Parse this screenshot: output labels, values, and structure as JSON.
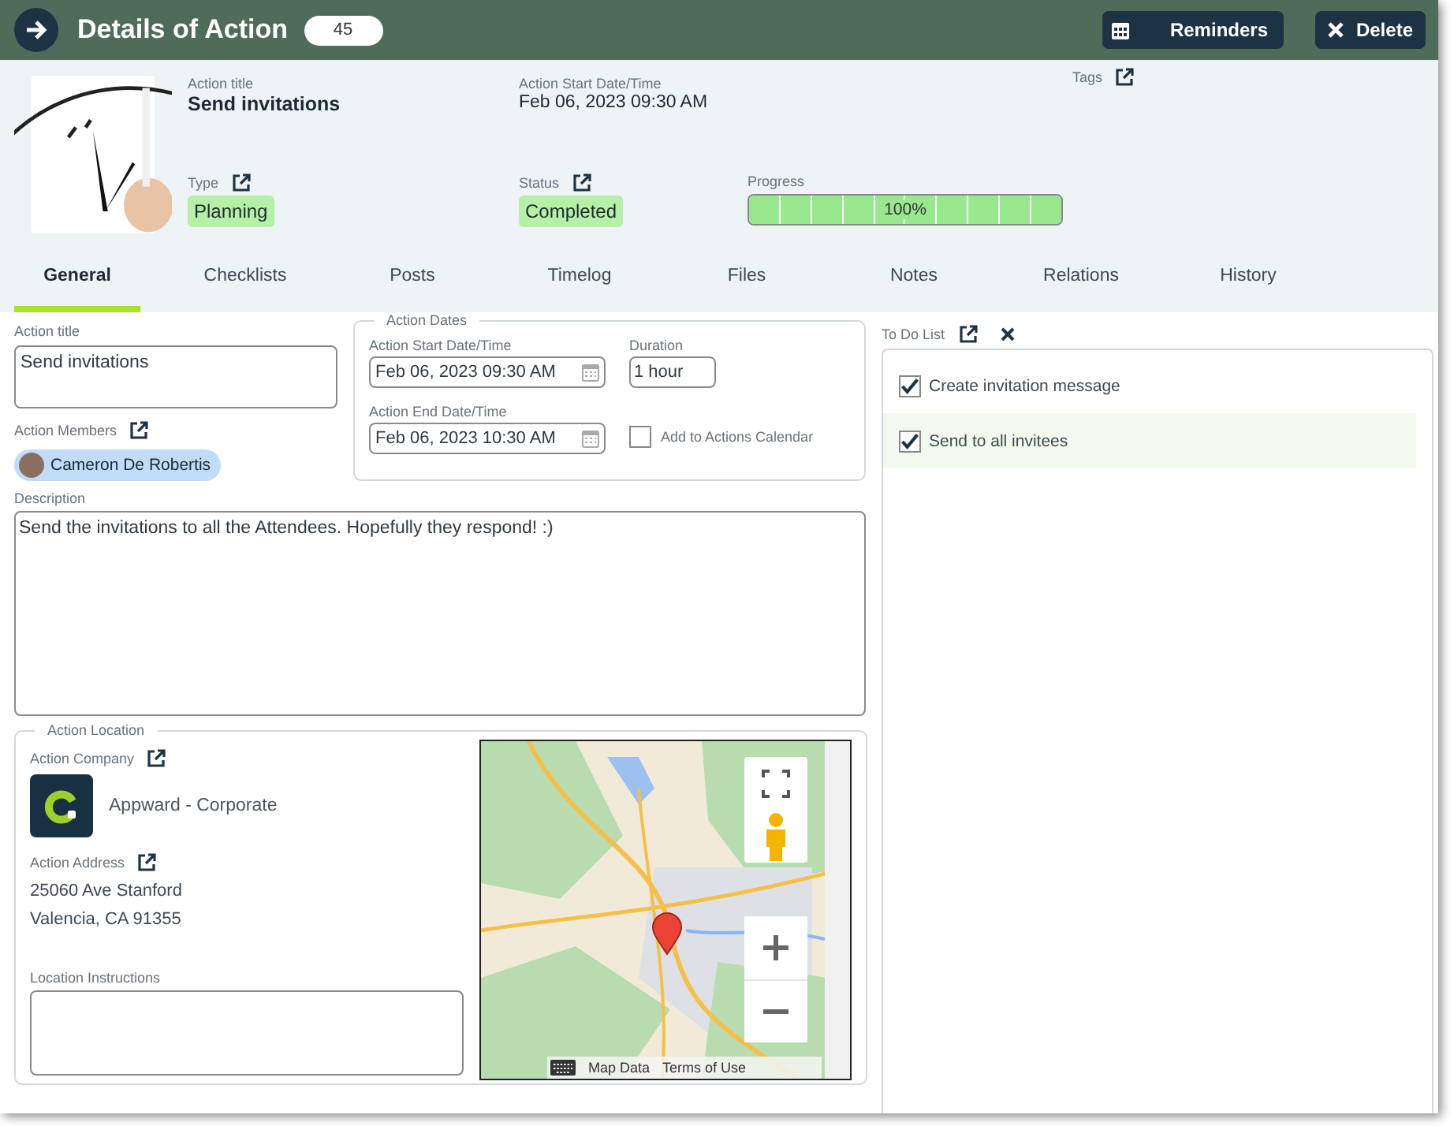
{
  "header": {
    "title": "Details of Action",
    "count": "45",
    "buttons": [
      {
        "label": "Reminders",
        "kind": "calendar"
      },
      {
        "label": "Delete",
        "kind": "close"
      }
    ]
  },
  "summary": {
    "title_label": "Action title",
    "title": "Send invitations",
    "start_label": "Action Start Date/Time",
    "start": "Feb 06, 2023 09:30 AM",
    "tags_label": "Tags",
    "type_label": "Type",
    "type": "Planning",
    "status_label": "Status",
    "status": "Completed",
    "progress_label": "Progress",
    "progress": {
      "level": 1,
      "reading": "100%"
    }
  },
  "tabs": [
    {
      "label": "General",
      "selected": true
    },
    {
      "label": "Checklists",
      "selected": false
    },
    {
      "label": "Posts",
      "selected": false
    },
    {
      "label": "Timelog",
      "selected": false
    },
    {
      "label": "Files",
      "selected": false
    },
    {
      "label": "Notes",
      "selected": false
    },
    {
      "label": "Relations",
      "selected": false
    },
    {
      "label": "History",
      "selected": false
    }
  ],
  "general": {
    "title_label": "Action title",
    "title": "Send invitations",
    "members_label": "Action Members",
    "members": [
      "Cameron De Robertis"
    ],
    "dates": {
      "legend": "Action Dates",
      "start_label": "Action Start Date/Time",
      "start": "Feb 06, 2023 09:30 AM",
      "duration_label": "Duration",
      "duration": "1 hour",
      "end_label": "Action End Date/Time",
      "end": "Feb 06, 2023 10:30 AM",
      "calendar_label": "Add to Actions Calendar",
      "calendar_checked": false
    },
    "description_label": "Description",
    "description": "Send the invitations to all the Attendees. Hopefully they respond! :)"
  },
  "location": {
    "legend": "Action Location",
    "company_label": "Action Company",
    "company": "Appward - Corporate",
    "address_label": "Action Address",
    "address": [
      "25060 Ave Stanford",
      "Valencia, CA 91355"
    ],
    "instructions_label": "Location Instructions",
    "map": {
      "links": [
        "Map Data",
        "Terms of Use"
      ]
    }
  },
  "todo": {
    "label": "To Do List",
    "items": [
      {
        "text": "Create invitation message",
        "checked": true,
        "selected": false
      },
      {
        "text": "Send to all invitees",
        "checked": true,
        "selected": true
      }
    ]
  }
}
